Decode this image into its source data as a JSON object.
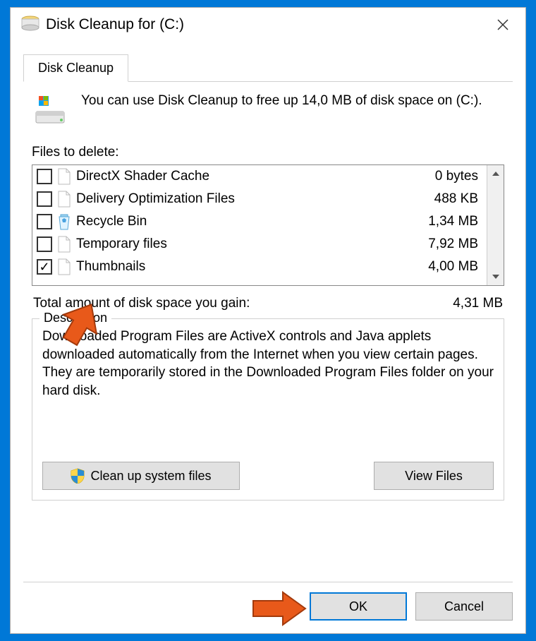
{
  "window": {
    "title": "Disk Cleanup for  (C:)"
  },
  "tab": {
    "label": "Disk Cleanup"
  },
  "intro": "You can use Disk Cleanup to free up 14,0 MB of disk space on  (C:).",
  "files_label": "Files to delete:",
  "files": [
    {
      "name": "DirectX Shader Cache",
      "size": "0 bytes",
      "checked": false,
      "icon": "file"
    },
    {
      "name": "Delivery Optimization Files",
      "size": "488 KB",
      "checked": false,
      "icon": "file"
    },
    {
      "name": "Recycle Bin",
      "size": "1,34 MB",
      "checked": false,
      "icon": "recycle"
    },
    {
      "name": "Temporary files",
      "size": "7,92 MB",
      "checked": false,
      "icon": "file"
    },
    {
      "name": "Thumbnails",
      "size": "4,00 MB",
      "checked": true,
      "icon": "file"
    }
  ],
  "total_label": "Total amount of disk space you gain:",
  "total_value": "4,31 MB",
  "desc_legend": "Description",
  "desc_text": "Downloaded Program Files are ActiveX controls and Java applets downloaded automatically from the Internet when you view certain pages. They are temporarily stored in the Downloaded Program Files folder on your hard disk.",
  "buttons": {
    "cleanup": "Clean up system files",
    "view": "View Files",
    "ok": "OK",
    "cancel": "Cancel"
  }
}
